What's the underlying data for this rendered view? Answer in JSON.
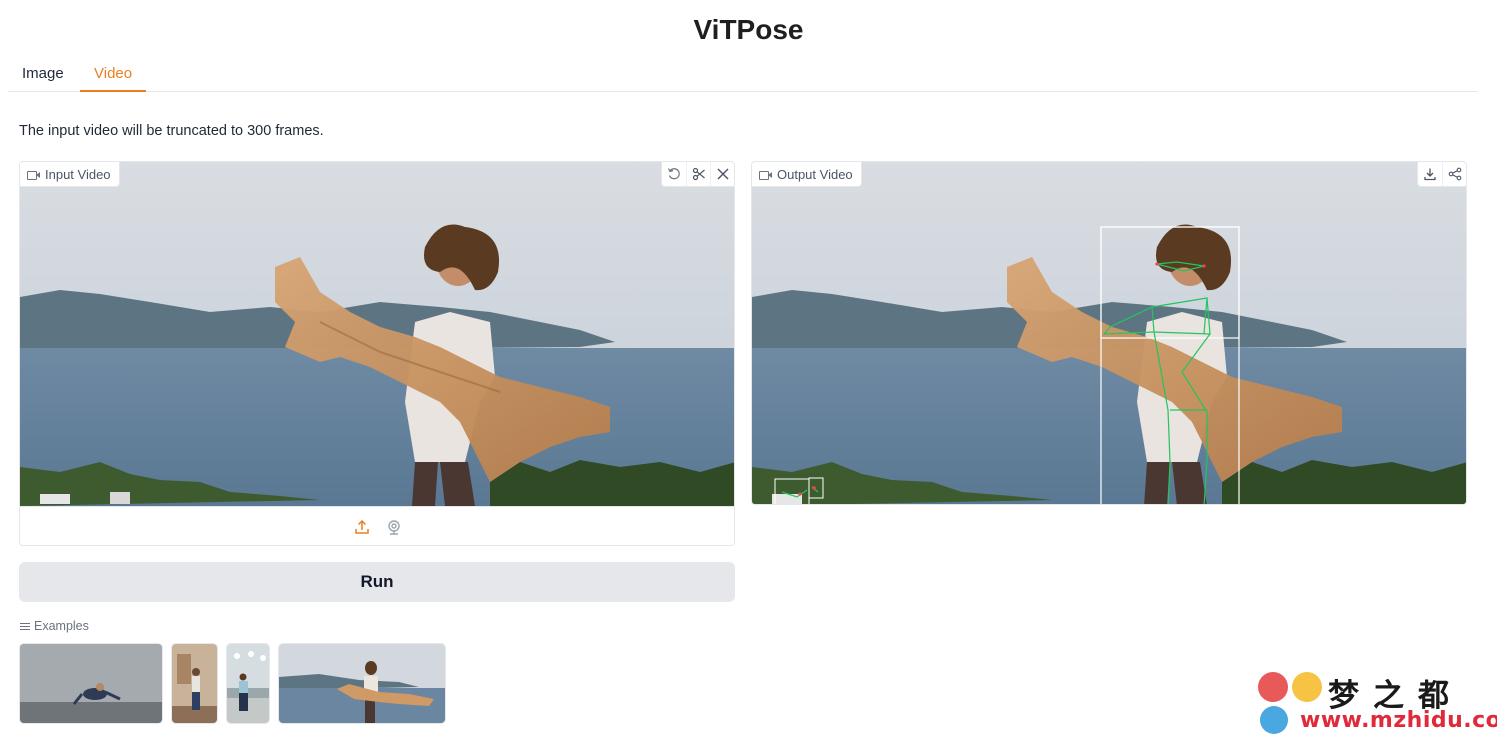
{
  "app": {
    "title": "ViTPose"
  },
  "tabs": [
    {
      "label": "Image",
      "active": false
    },
    {
      "label": "Video",
      "active": true
    }
  ],
  "note": "The input video will be truncated to 300 frames.",
  "input_panel": {
    "label": "Input Video",
    "tools": [
      "undo-icon",
      "scissors-icon",
      "close-icon"
    ],
    "upload_buttons": [
      "upload-icon",
      "webcam-icon"
    ]
  },
  "output_panel": {
    "label": "Output Video",
    "tools": [
      "download-icon",
      "share-icon"
    ]
  },
  "run_button": {
    "label": "Run"
  },
  "examples": {
    "label": "Examples",
    "items": [
      "example-breakdance",
      "example-dancer-room",
      "example-dancer-hall",
      "example-scarf-dancer"
    ]
  },
  "watermark": {
    "title": "梦之都",
    "url": "www.mzhidu.com"
  },
  "colors": {
    "accent": "#ea7f1f",
    "button_bg": "#e5e7eb",
    "skeleton": "#22c55e",
    "box": "#ffffff"
  }
}
